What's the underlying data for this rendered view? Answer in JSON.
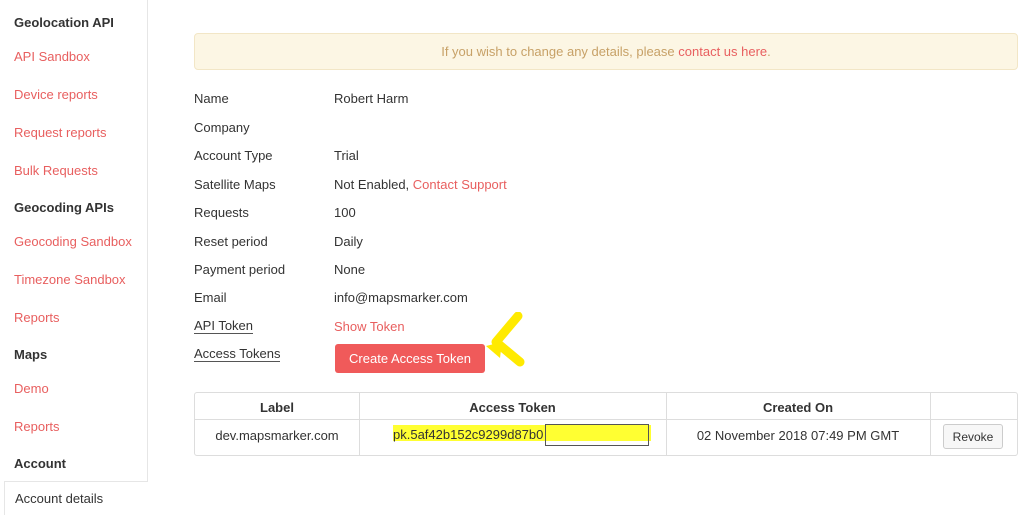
{
  "sidebar": {
    "sections": [
      {
        "heading": "Geolocation API",
        "items": [
          "API Sandbox",
          "Device reports",
          "Request reports",
          "Bulk Requests"
        ]
      },
      {
        "heading": "Geocoding APIs",
        "items": [
          "Geocoding Sandbox",
          "Timezone Sandbox",
          "Reports"
        ]
      },
      {
        "heading": "Maps",
        "items": [
          "Demo",
          "Reports"
        ]
      },
      {
        "heading": "Account",
        "items": [
          "Account details"
        ]
      }
    ],
    "active_item": "Account details",
    "link_color": "#e85f5f"
  },
  "notice": {
    "text": "If you wish to change any details, please ",
    "link": "contact us here",
    "suffix": "."
  },
  "details": [
    {
      "label": "Name",
      "value": "Robert Harm"
    },
    {
      "label": "Company",
      "value": ""
    },
    {
      "label": "Account Type",
      "value": "Trial"
    },
    {
      "label": "Satellite Maps",
      "value": "Not Enabled, ",
      "link": "Contact Support"
    },
    {
      "label": "Requests",
      "value": "100"
    },
    {
      "label": "Reset period",
      "value": "Daily"
    },
    {
      "label": "Payment period",
      "value": "None"
    },
    {
      "label": "Email",
      "value": "info@mapsmarker.com"
    },
    {
      "label": "API Token",
      "value": "",
      "link": "Show Token"
    },
    {
      "label": "Access Tokens",
      "button": "Create Access Token"
    }
  ],
  "table": {
    "headers": [
      "Label",
      "Access Token",
      "Created On",
      ""
    ],
    "rows": [
      {
        "label": "dev.mapsmarker.com",
        "token": "pk.5af42b152c9299d87b0",
        "created": "02 November 2018 07:49 PM GMT",
        "action": "Revoke"
      }
    ]
  },
  "colors": {
    "accent": "#f05a5a",
    "highlight": "#ffff32",
    "notice_bg": "#fcf6e4"
  }
}
